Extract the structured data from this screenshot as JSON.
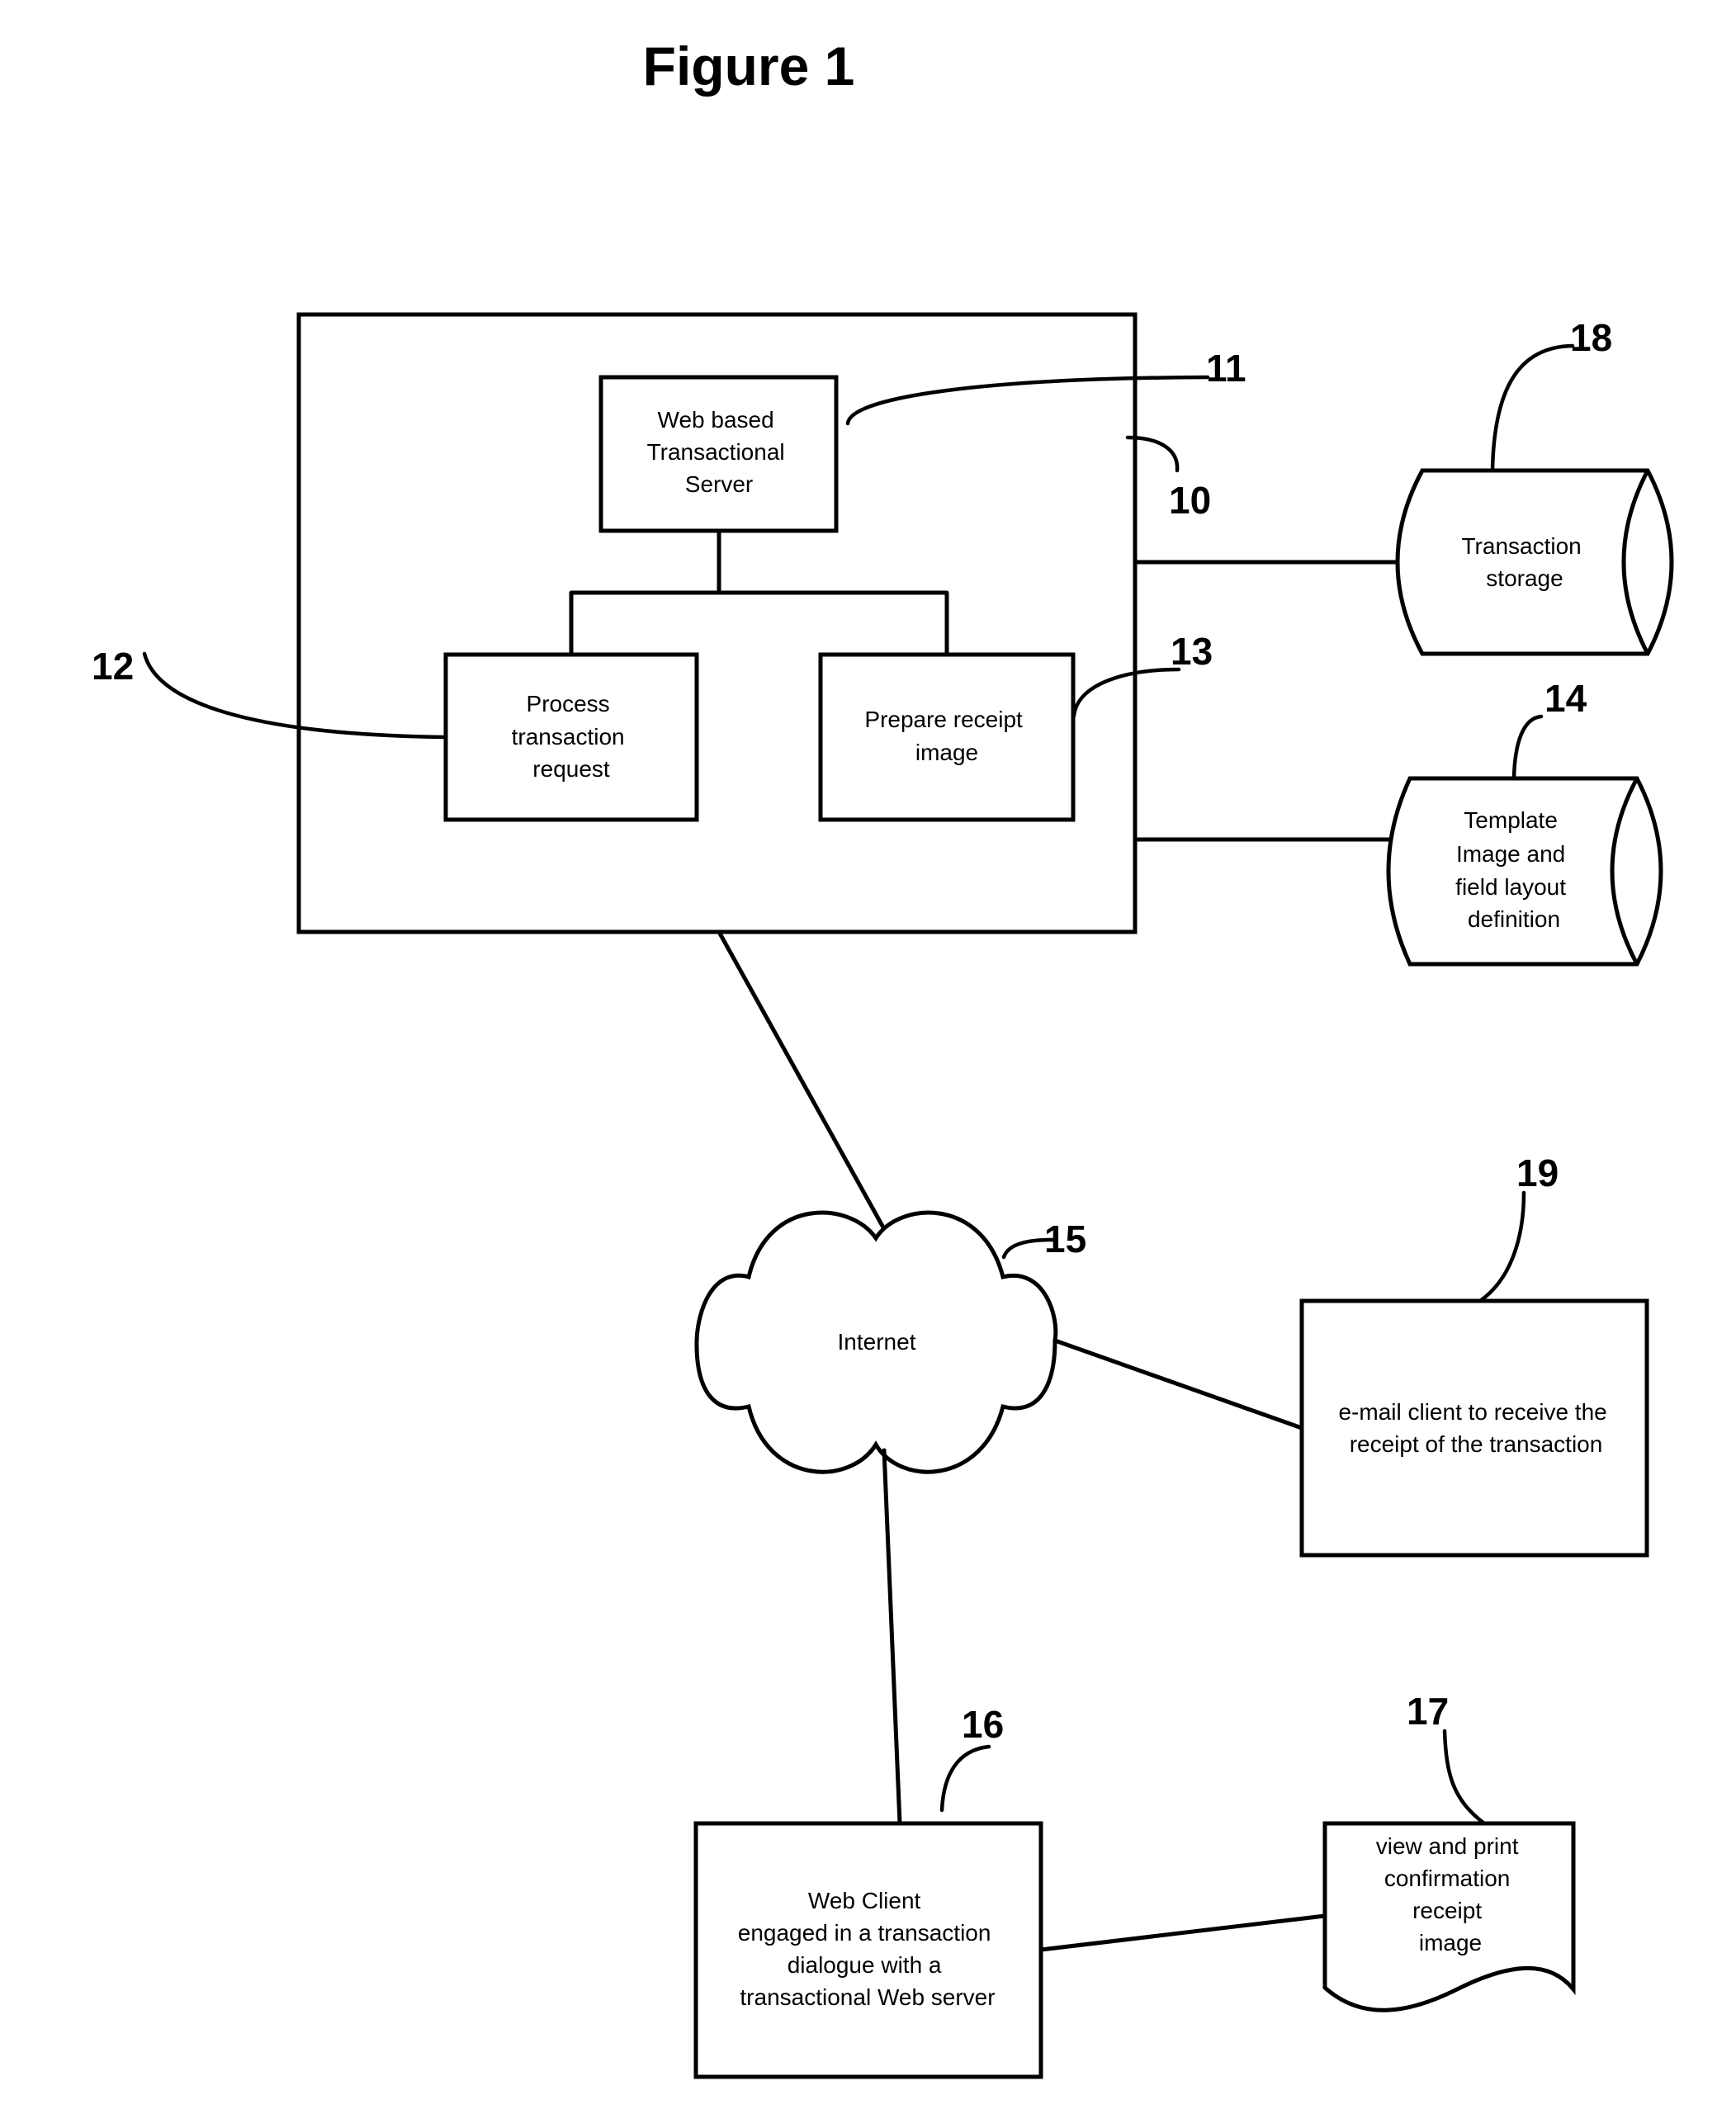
{
  "figure": {
    "title": "Figure 1"
  },
  "nodes": {
    "system": {
      "ref": "10"
    },
    "web_server": {
      "ref": "11",
      "lines": [
        "Web based",
        "Transactional",
        "Server"
      ]
    },
    "process_request": {
      "ref": "12",
      "lines": [
        "Process",
        "transaction",
        "request"
      ]
    },
    "prepare_receipt": {
      "ref": "13",
      "lines": [
        "Prepare receipt",
        "image"
      ]
    },
    "template_store": {
      "ref": "14",
      "lines": [
        "Template",
        "Image and",
        "field layout",
        "definition"
      ]
    },
    "internet": {
      "ref": "15",
      "lines": [
        "Internet"
      ]
    },
    "web_client": {
      "ref": "16",
      "lines": [
        "Web Client",
        "engaged in a transaction",
        "dialogue with a",
        "transactional Web server"
      ]
    },
    "receipt_document": {
      "ref": "17",
      "lines": [
        "view and print",
        "confirmation",
        "receipt",
        "image"
      ]
    },
    "transaction_storage": {
      "ref": "18",
      "lines": [
        "Transaction",
        "storage"
      ]
    },
    "email_client": {
      "ref": "19",
      "lines": [
        "e-mail client to receive the",
        "receipt of the transaction"
      ]
    }
  },
  "edges": [
    {
      "from": "web_server",
      "to": "process_request"
    },
    {
      "from": "web_server",
      "to": "prepare_receipt"
    },
    {
      "from": "system",
      "to": "transaction_storage"
    },
    {
      "from": "system",
      "to": "template_store"
    },
    {
      "from": "system",
      "to": "internet"
    },
    {
      "from": "internet",
      "to": "email_client"
    },
    {
      "from": "internet",
      "to": "web_client"
    },
    {
      "from": "web_client",
      "to": "receipt_document"
    }
  ],
  "colors": {
    "ink": "#000000",
    "paper": "#ffffff"
  }
}
